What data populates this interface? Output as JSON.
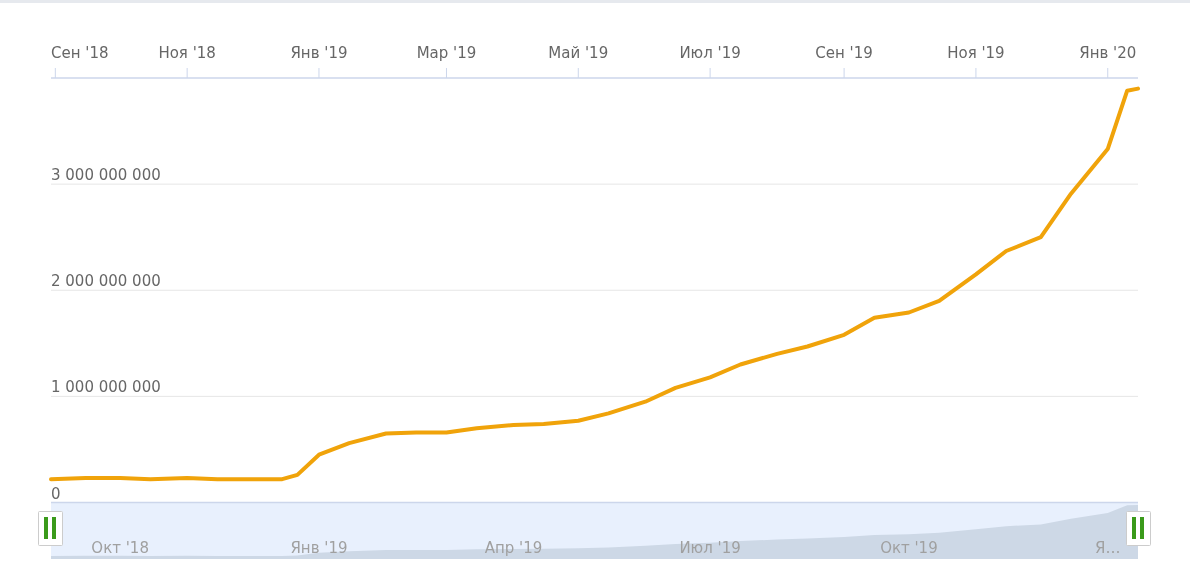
{
  "chart": {
    "chart_data": {
      "type": "line",
      "grid": true,
      "xlim": [
        "2018-08-30",
        "2020-01-15"
      ],
      "ylim": [
        0,
        4000000000
      ],
      "xticks": [
        {
          "value": "2018-09-01",
          "label": "Сен '18"
        },
        {
          "value": "2018-11-01",
          "label": "Ноя '18"
        },
        {
          "value": "2019-01-01",
          "label": "Янв '19"
        },
        {
          "value": "2019-03-01",
          "label": "Мар '19"
        },
        {
          "value": "2019-05-01",
          "label": "Май '19"
        },
        {
          "value": "2019-07-01",
          "label": "Июл '19"
        },
        {
          "value": "2019-09-01",
          "label": "Сен '19"
        },
        {
          "value": "2019-11-01",
          "label": "Ноя '19"
        },
        {
          "value": "2020-01-01",
          "label": "Янв '20"
        }
      ],
      "yticks": [
        {
          "value": 0,
          "label": "0"
        },
        {
          "value": 1000000000,
          "label": "1 000 000 000"
        },
        {
          "value": 2000000000,
          "label": "2 000 000 000"
        },
        {
          "value": 3000000000,
          "label": "3 000 000 000"
        }
      ],
      "x": [
        "2018-08-30",
        "2018-09-15",
        "2018-10-01",
        "2018-10-15",
        "2018-11-01",
        "2018-11-15",
        "2018-12-01",
        "2018-12-15",
        "2018-12-22",
        "2019-01-01",
        "2019-01-15",
        "2019-02-01",
        "2019-02-15",
        "2019-03-01",
        "2019-03-15",
        "2019-04-01",
        "2019-04-15",
        "2019-05-01",
        "2019-05-15",
        "2019-06-01",
        "2019-06-15",
        "2019-07-01",
        "2019-07-15",
        "2019-08-01",
        "2019-08-15",
        "2019-09-01",
        "2019-09-15",
        "2019-10-01",
        "2019-10-15",
        "2019-11-01",
        "2019-11-15",
        "2019-12-01",
        "2019-12-15",
        "2020-01-01",
        "2020-01-10",
        "2020-01-15"
      ],
      "series": [
        {
          "color": "#f0a30a",
          "values": [
            220000000,
            230000000,
            230000000,
            220000000,
            230000000,
            220000000,
            220000000,
            220000000,
            260000000,
            450000000,
            560000000,
            650000000,
            660000000,
            660000000,
            700000000,
            730000000,
            740000000,
            770000000,
            840000000,
            950000000,
            1080000000,
            1180000000,
            1300000000,
            1400000000,
            1470000000,
            1580000000,
            1740000000,
            1790000000,
            1900000000,
            2150000000,
            2370000000,
            2500000000,
            2910000000,
            3330000000,
            3880000000,
            3900000000
          ]
        }
      ]
    }
  },
  "navigator": {
    "labels": [
      "Окт '18",
      "Янв '19",
      "Апр '19",
      "Июл '19",
      "Окт '19",
      "Я…"
    ]
  }
}
